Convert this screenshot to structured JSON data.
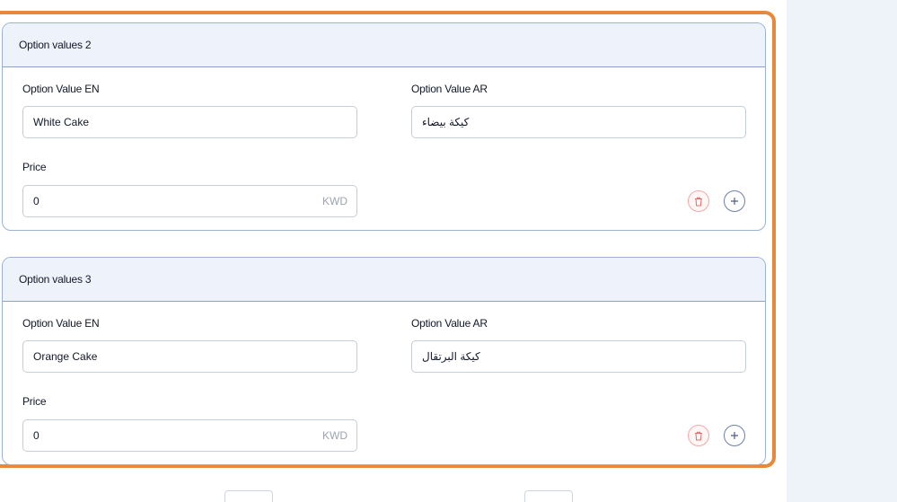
{
  "option_cards": [
    {
      "title": "Option values 2",
      "value_en_label": "Option Value EN",
      "value_en": "White Cake",
      "value_ar_label": "Option Value AR",
      "value_ar": "كيكة بيضاء",
      "price_label": "Price",
      "price": "0",
      "currency": "KWD",
      "delete_icon": "trash-icon",
      "add_icon": "plus-icon"
    },
    {
      "title": "Option values 3",
      "value_en_label": "Option Value EN",
      "value_en": "Orange Cake",
      "value_ar_label": "Option Value AR",
      "value_ar": "كيكة البرتقال",
      "price_label": "Price",
      "price": "0",
      "currency": "KWD",
      "delete_icon": "trash-icon",
      "add_icon": "plus-icon"
    }
  ],
  "colors": {
    "highlight_border": "#e8883a",
    "card_border": "#9bb3d3",
    "card_header_bg": "#eef2fb",
    "side_panel_bg": "#eef2f9",
    "delete_icon_color": "#e26d6d",
    "add_icon_color": "#4b5f86"
  }
}
